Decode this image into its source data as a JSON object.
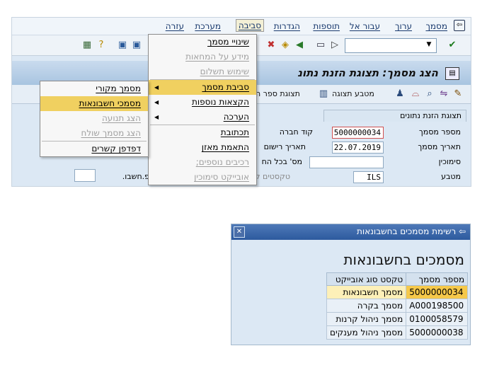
{
  "menubar": {
    "items": [
      {
        "label": "מסמך"
      },
      {
        "label": "ערוך"
      },
      {
        "label": "עבור אל"
      },
      {
        "label": "תוספות"
      },
      {
        "label": "הגדרות"
      },
      {
        "label": "סביבה"
      },
      {
        "label": "מערכת"
      },
      {
        "label": "עזרה"
      }
    ]
  },
  "toolbar": {
    "command_value": ""
  },
  "title": {
    "text": "הצג מסמך: תצוגת הזנת נתונ"
  },
  "app_toolbar": {
    "display_doc_label": "תצוגת מסמך",
    "display_currency_label": "מטבע תצוגה",
    "ref_label": "תצוגת ספר ה"
  },
  "form": {
    "group_header": "תצוגת הזנת נתונים",
    "fields": [
      {
        "label": "מספר מסמך",
        "value": "5000000034"
      },
      {
        "label": "תאריך מסמך",
        "value": "22.07.2019"
      },
      {
        "label": "סימוכין",
        "value": ""
      },
      {
        "label": "מטבע",
        "value": "ILS"
      }
    ],
    "company_code_label": "קוד חברה",
    "posting_date_label": "תאריך רישום",
    "ledger_doc_label": "מס' בכל הח",
    "existing_texts_label": "טקסטים קיימי",
    "fiscal_label": "פ.חשבו."
  },
  "env_menu": {
    "items": [
      {
        "label": "שינויי מסמך",
        "disabled": false,
        "has_sub": false
      },
      {
        "label": "מידע על המחאות",
        "disabled": true,
        "has_sub": false
      },
      {
        "label": "שימוש תשלום",
        "disabled": true,
        "has_sub": false
      },
      {
        "label": "סביבת מסמך",
        "disabled": false,
        "has_sub": true,
        "highlight": true
      },
      {
        "label": "הקצאות נוספות",
        "disabled": false,
        "has_sub": true
      },
      {
        "label": "הערכה",
        "disabled": false,
        "has_sub": true
      },
      {
        "label": "תכתובת",
        "disabled": false,
        "has_sub": false
      },
      {
        "label": "התאמת מאזן",
        "disabled": false,
        "has_sub": false
      },
      {
        "label": "רכיבים נוספים;",
        "disabled": true,
        "has_sub": false
      },
      {
        "label": "אובייקט סימוכין",
        "disabled": true,
        "has_sub": false
      }
    ]
  },
  "sub_menu": {
    "items": [
      {
        "label": "מסמך מקורי",
        "disabled": false
      },
      {
        "label": "מסמכי חשבונאות",
        "disabled": false,
        "highlight": true
      },
      {
        "label": "הצג תנועה",
        "disabled": true
      },
      {
        "label": "הצג מסמך שולח",
        "disabled": true
      },
      {
        "label": "דפדפן קשרים",
        "disabled": false
      }
    ]
  },
  "dialog": {
    "title": "רשימת מסמכים בחשבונאות",
    "heading": "מסמכים בחשבונאות",
    "columns": [
      "מספר מסמך",
      "טקסט סוג אובייקט"
    ],
    "rows": [
      {
        "doc": "5000000034",
        "type": "מסמך חשבונאות"
      },
      {
        "doc": "A000198500",
        "type": "מסמך בקרה"
      },
      {
        "doc": "0100058579",
        "type": "מסמך ניהול קרנות"
      },
      {
        "doc": "5000000038",
        "type": "מסמך ניהול מענקים"
      }
    ]
  },
  "colors": {
    "highlight": "#f0d060",
    "title_blue": "#2d5a9e"
  }
}
